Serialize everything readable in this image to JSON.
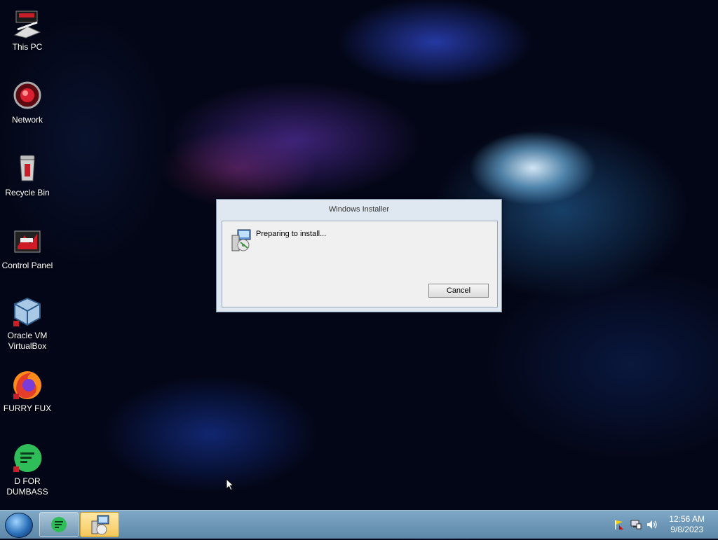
{
  "desktop": {
    "icons": [
      {
        "label": "This PC"
      },
      {
        "label": "Network"
      },
      {
        "label": "Recycle Bin"
      },
      {
        "label": "Control Panel"
      },
      {
        "label": "Oracle VM VirtualBox"
      },
      {
        "label": "FURRY FUX"
      },
      {
        "label": "D FOR DUMBASS"
      }
    ]
  },
  "dialog": {
    "title": "Windows Installer",
    "message": "Preparing to install...",
    "cancel_label": "Cancel"
  },
  "taskbar": {
    "clock_time": "12:56 AM",
    "clock_date": "9/8/2023"
  }
}
